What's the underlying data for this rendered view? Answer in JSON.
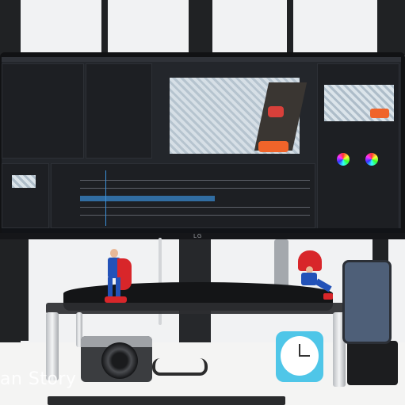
{
  "scene": {
    "watermark": "an Story",
    "monitor_logo": "LG",
    "colors": {
      "wall": "#f1f2f3",
      "screen_bg": "#23262b",
      "accent": "#3a8fd8",
      "timer": "#4fc6e8",
      "phone": "#4e5f78"
    }
  }
}
